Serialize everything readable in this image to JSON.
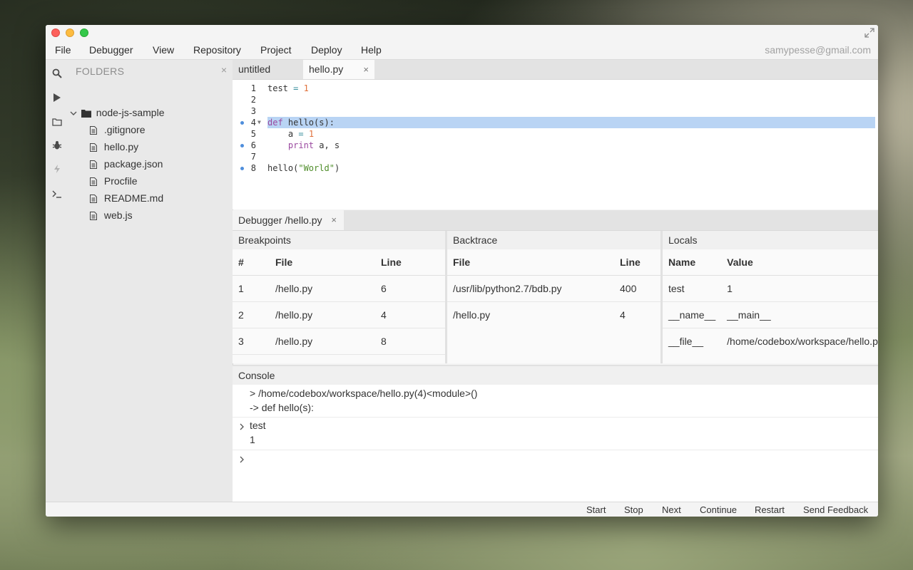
{
  "window": {
    "user_email": "samypesse@gmail.com"
  },
  "menu": [
    "File",
    "Debugger",
    "View",
    "Repository",
    "Project",
    "Deploy",
    "Help"
  ],
  "activity_icons": [
    "search-icon",
    "run-icon",
    "folder-icon",
    "debug-bug-icon",
    "lightning-icon",
    "terminal-icon"
  ],
  "sidebar": {
    "header": "FOLDERS",
    "close": "×",
    "root_folder": "node-js-sample",
    "files": [
      ".gitignore",
      "hello.py",
      "package.json",
      "Procfile",
      "README.md",
      "web.js"
    ]
  },
  "editor": {
    "tabs": [
      {
        "label": "untitled",
        "active": false
      },
      {
        "label": "hello.py",
        "active": true,
        "close": "×"
      }
    ],
    "lines": [
      {
        "n": "1",
        "text": "test = 1",
        "breakpoint": false
      },
      {
        "n": "2",
        "text": "",
        "breakpoint": false
      },
      {
        "n": "3",
        "text": "",
        "breakpoint": false
      },
      {
        "n": "4",
        "text": "def hello(s):",
        "breakpoint": true,
        "highlighted": true
      },
      {
        "n": "5",
        "text": "    a = 1",
        "breakpoint": false
      },
      {
        "n": "6",
        "text": "    print a, s",
        "breakpoint": true
      },
      {
        "n": "7",
        "text": "",
        "breakpoint": false
      },
      {
        "n": "8",
        "text": "hello(\"World\")",
        "breakpoint": true
      }
    ]
  },
  "debugger": {
    "tab_label": "Debugger /hello.py",
    "tab_close": "×",
    "breakpoints": {
      "title": "Breakpoints",
      "columns": [
        "#",
        "File",
        "Line"
      ],
      "rows": [
        [
          "1",
          "/hello.py",
          "6"
        ],
        [
          "2",
          "/hello.py",
          "4"
        ],
        [
          "3",
          "/hello.py",
          "8"
        ]
      ]
    },
    "backtrace": {
      "title": "Backtrace",
      "columns": [
        "File",
        "Line"
      ],
      "rows": [
        [
          "/usr/lib/python2.7/bdb.py",
          "400"
        ],
        [
          "/hello.py",
          "4"
        ]
      ]
    },
    "locals": {
      "title": "Locals",
      "columns": [
        "Name",
        "Value"
      ],
      "rows": [
        [
          "test",
          "1"
        ],
        [
          "__name__",
          "__main__"
        ],
        [
          "__file__",
          "/home/codebox/workspace/hello.py"
        ]
      ]
    }
  },
  "console": {
    "title": "Console",
    "output1": "> /home/codebox/workspace/hello.py(4)<module>()",
    "output2": "-> def hello(s):",
    "cmd": "test",
    "result": "1",
    "prompt": ">"
  },
  "statusbar": {
    "buttons": [
      "Start",
      "Stop",
      "Next",
      "Continue",
      "Restart",
      "Send Feedback"
    ]
  }
}
